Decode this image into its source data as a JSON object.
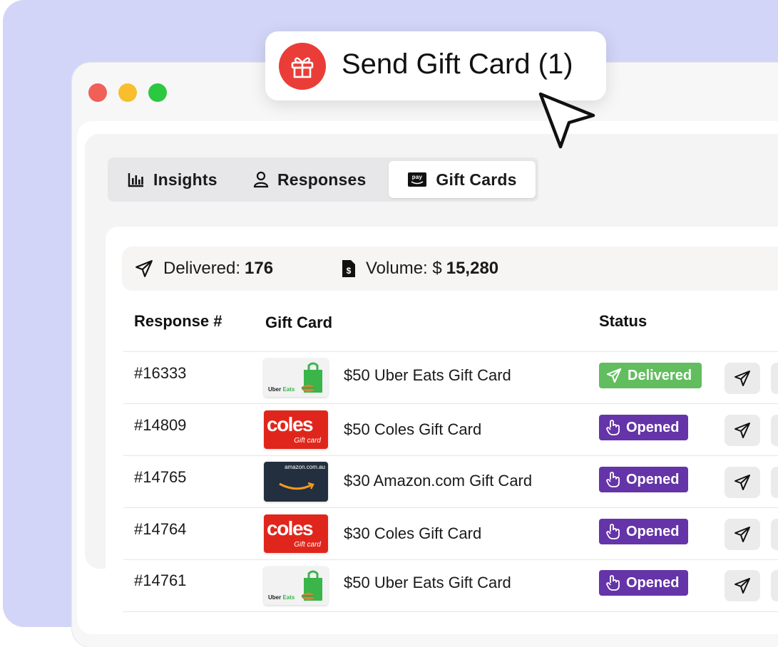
{
  "toast": {
    "label": "Send Gift Card (1)",
    "icon": "gift-icon"
  },
  "tabs": [
    {
      "label": "Insights",
      "icon": "bar-chart-icon"
    },
    {
      "label": "Responses",
      "icon": "user-icon"
    },
    {
      "label": "Gift Cards",
      "icon": "amazon-pay-icon",
      "active": true
    }
  ],
  "stats": {
    "delivered_label": "Delivered:",
    "delivered_value": "176",
    "volume_label": "Volume: $",
    "volume_value": "15,280"
  },
  "table": {
    "headers": {
      "response": "Response #",
      "gift_card": "Gift Card",
      "status": "Status"
    },
    "rows": [
      {
        "id": "#16333",
        "brand": "uber",
        "gift_card": "$50 Uber Eats Gift Card",
        "status": "Delivered"
      },
      {
        "id": "#14809",
        "brand": "coles",
        "gift_card": "$50 Coles Gift Card",
        "status": "Opened"
      },
      {
        "id": "#14765",
        "brand": "amazon",
        "gift_card": "$30 Amazon.com Gift Card",
        "status": "Opened"
      },
      {
        "id": "#14764",
        "brand": "coles",
        "gift_card": "$30 Coles Gift Card",
        "status": "Opened"
      },
      {
        "id": "#14761",
        "brand": "uber",
        "gift_card": "$50 Uber Eats Gift Card",
        "status": "Opened"
      }
    ]
  },
  "thumb_text": {
    "coles": "coles",
    "coles_sub": "Gift card",
    "uber_a": "Uber",
    "uber_b": "Eats",
    "amazon": "amazon.com.au"
  },
  "colors": {
    "delivered": "#62bd5e",
    "opened": "#6434a8",
    "toast_icon": "#ea3d38",
    "background": "#d2d5f7"
  }
}
